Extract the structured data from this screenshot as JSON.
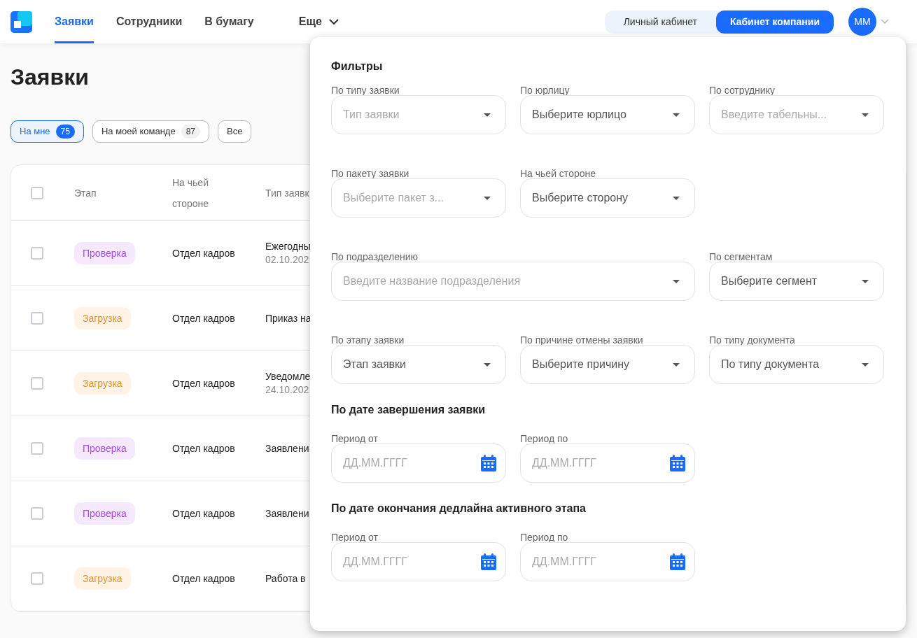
{
  "nav": {
    "tabs": [
      {
        "label": "Заявки",
        "selected": true
      },
      {
        "label": "Сотрудники",
        "selected": false
      },
      {
        "label": "В бумагу",
        "selected": false
      }
    ],
    "more": "Еще"
  },
  "account_switch": [
    {
      "label": "Личный кабинет",
      "selected": false
    },
    {
      "label": "Кабинет компании",
      "selected": true
    }
  ],
  "avatar": "ММ",
  "page_title": "Заявки",
  "chips": [
    {
      "label": "На мне",
      "count": "75",
      "selected": true
    },
    {
      "label": "На моей команде",
      "count": "87",
      "selected": false
    },
    {
      "label": "Все",
      "selected": false
    }
  ],
  "table": {
    "select_all": {
      "checked": false
    },
    "columns": [
      "Этап",
      "На чьей стороне",
      "Тип заявк"
    ],
    "rows": [
      {
        "checked": false,
        "stage": "Проверка",
        "kind": "review",
        "side": "Отдел кадров",
        "type": "Ежегодны",
        "date": "02.10.202"
      },
      {
        "checked": false,
        "stage": "Загрузка",
        "kind": "upload",
        "side": "Отдел кадров",
        "type": "Приказ на"
      },
      {
        "checked": false,
        "stage": "Загрузка",
        "kind": "upload",
        "side": "Отдел кадров",
        "type": "Уведомле",
        "date": "24.10.202"
      },
      {
        "checked": false,
        "stage": "Проверка",
        "kind": "review",
        "side": "Отдел кадров",
        "type": "Заявлени"
      },
      {
        "checked": false,
        "stage": "Проверка",
        "kind": "review",
        "side": "Отдел кадров",
        "type": "Заявлени"
      },
      {
        "checked": false,
        "stage": "Загрузка",
        "kind": "upload",
        "side": "Отдел кадров",
        "type": "Работа в"
      }
    ]
  },
  "filters": {
    "title": "Фильтры",
    "rows": [
      [
        {
          "kind": "select",
          "label": "По типу заявки",
          "placeholder": "Тип заявки"
        },
        {
          "kind": "select",
          "label": "По юрлицу",
          "value": "Выберите юрлицо"
        },
        {
          "kind": "select",
          "label": "По сотруднику",
          "placeholder": "Введите табельны..."
        }
      ],
      [
        {
          "kind": "select",
          "label": "По пакету заявки",
          "placeholder": "Выберите пакет з..."
        },
        {
          "kind": "select",
          "label": "На чьей стороне",
          "value": "Выберите сторону"
        }
      ],
      [
        {
          "kind": "select",
          "label": "По подразделению",
          "placeholder": "Введите название подразделения"
        },
        "",
        {
          "kind": "select",
          "label": "По сегментам",
          "value": "Выберите сегмент"
        }
      ],
      [
        {
          "kind": "select",
          "label": "По этапу заявки",
          "value": "Этап заявки"
        },
        {
          "kind": "select",
          "label": "По причине отмены заявки",
          "value": "Выберите причину"
        },
        {
          "kind": "select",
          "label": "По типу документа",
          "value": "По типу документа"
        }
      ]
    ],
    "date_sections": [
      {
        "title": "По дате завершения заявки",
        "fields": [
          {
            "label": "Период от",
            "placeholder": "ДД.ММ.ГГГГ"
          },
          {
            "label": "Период по",
            "placeholder": "ДД.ММ.ГГГГ"
          }
        ]
      },
      {
        "title": "По дате окончания дедлайна активного этапа",
        "fields": [
          {
            "label": "Период от",
            "placeholder": "ДД.ММ.ГГГГ"
          },
          {
            "label": "Период по",
            "placeholder": "ДД.ММ.ГГГГ"
          }
        ]
      }
    ]
  }
}
